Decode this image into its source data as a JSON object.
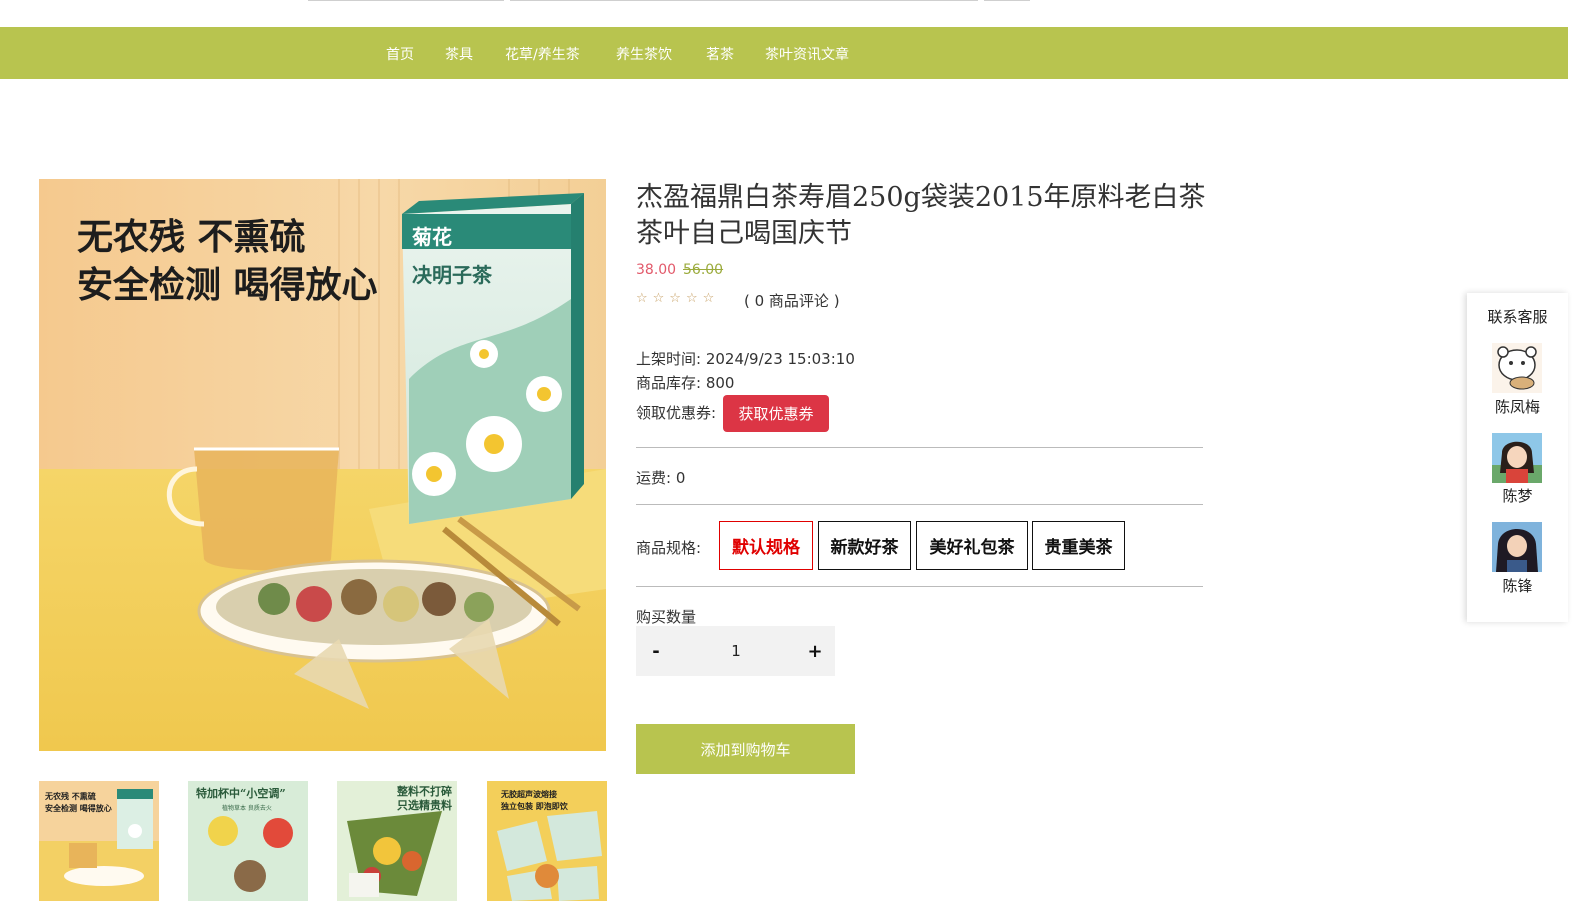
{
  "nav": {
    "items": [
      "首页",
      "茶具",
      "花草/养生茶",
      "养生茶饮",
      "茗茶",
      "茶叶资讯文章"
    ]
  },
  "gallery": {
    "main": {
      "headline_line1": "无农残 不熏硫",
      "headline_line2": "安全检测 喝得放心",
      "box_label_1": "菊花",
      "box_label_2": "决明子茶"
    },
    "thumbs": [
      {
        "caption1": "无农残 不熏硫",
        "caption2": "安全检测 喝得放心"
      },
      {
        "caption1": "特加杯中“小空调”",
        "caption2": "植物草本 良质去火"
      },
      {
        "caption1": "整料不打碎",
        "caption2": "只选精贵料"
      },
      {
        "caption1": "无胶超声波熔接",
        "caption2": "独立包装 即泡即饮"
      }
    ]
  },
  "product": {
    "title": "杰盈福鼎白茶寿眉250g袋装2015年原料老白茶茶叶自己喝国庆节",
    "price": "38.00",
    "old_price": "56.00",
    "rating_stars": "☆☆☆☆☆",
    "review_count": "( 0 商品评论 )",
    "listed_time": "上架时间: 2024/9/23 15:03:10",
    "stock": "商品库存: 800",
    "coupon_label": "领取优惠券:",
    "coupon_button": "获取优惠券",
    "shipping": "运费: 0",
    "spec_label": "商品规格:",
    "specs": [
      "默认规格",
      "新款好茶",
      "美好礼包茶",
      "贵重美茶"
    ],
    "selected_spec": "默认规格",
    "qty_label": "购买数量",
    "qty_minus": "-",
    "qty_value": "1",
    "qty_plus": "+",
    "add_to_cart": "添加到购物车"
  },
  "customer_service": {
    "title": "联系客服",
    "agents": [
      "陈凤梅",
      "陈梦",
      "陈锋"
    ]
  },
  "colors": {
    "nav_bg": "#b8c44f",
    "price": "#e2596a",
    "old_price": "#9bab3c",
    "coupon_btn": "#dc3545",
    "spec_active": "#e00000"
  }
}
